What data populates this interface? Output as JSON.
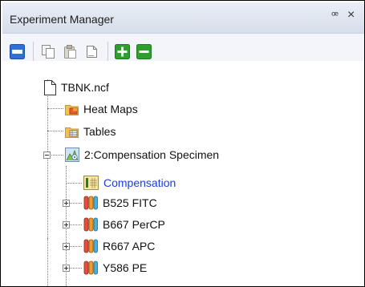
{
  "panel": {
    "title": "Experiment Manager",
    "pin_glyph": "ꟹ",
    "close_glyph": "×"
  },
  "toolbar": {
    "items": [
      {
        "icon": "new-experiment-icon"
      },
      {
        "icon": "copy-icon"
      },
      {
        "icon": "paste-icon"
      },
      {
        "icon": "duplicate-icon"
      },
      {
        "icon": "add-icon"
      },
      {
        "icon": "remove-icon"
      }
    ]
  },
  "tree": {
    "file": "TBNK.ncf",
    "heatmaps": "Heat Maps",
    "tables": "Tables",
    "specimen": "2:Compensation Specimen",
    "compensation": "Compensation",
    "tubes": [
      "B525 FITC",
      "B667 PerCP",
      "R667 APC",
      "Y586 PE"
    ]
  },
  "colors": {
    "selected_text": "#1a3fd9",
    "add_green": "#2e9e2e",
    "remove_green": "#2e9e2e",
    "toolbar_blue": "#2f6fd6"
  }
}
